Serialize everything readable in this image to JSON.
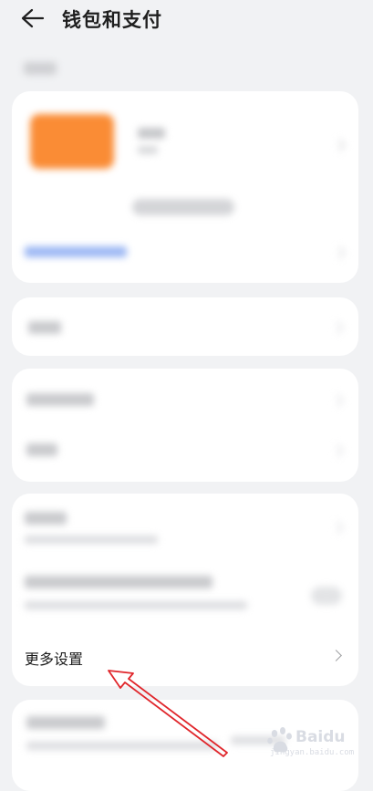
{
  "header": {
    "title": "钱包和支付",
    "back_icon": "arrow-left-icon"
  },
  "more_settings": {
    "label": "更多设置",
    "chevron_icon": "chevron-right-icon"
  },
  "annotation": {
    "arrow_color": "#e0262b"
  },
  "colors": {
    "background": "#f1f2f4",
    "card": "#ffffff",
    "bank_card": "#fa8c35",
    "link_blue": "#9db8f4"
  },
  "watermark": {
    "brand": "Baidu",
    "url": "jingyan.baidu.com"
  }
}
